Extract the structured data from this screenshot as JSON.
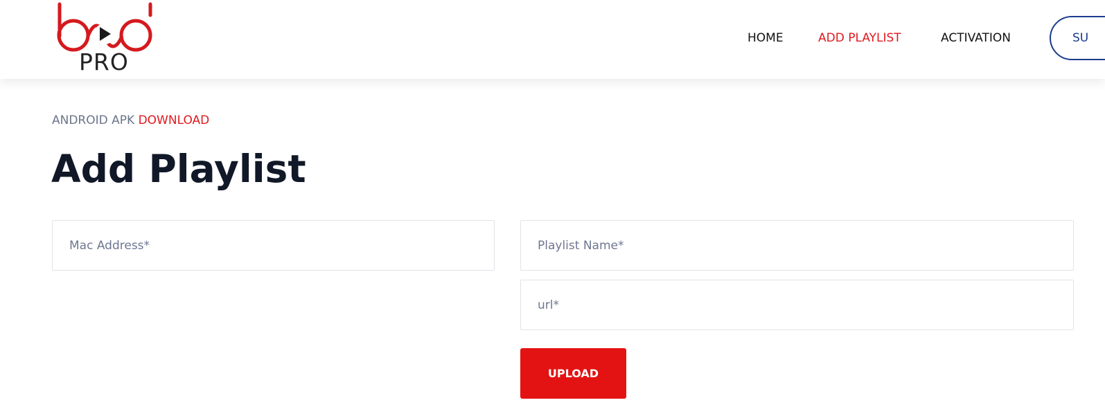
{
  "header": {
    "logo_text": "PRO",
    "nav": {
      "home": "HOME",
      "add_playlist": "ADD PLAYLIST",
      "activation": "ACTIVATION",
      "pill_label": "SU"
    }
  },
  "main": {
    "apk_prefix": "ANDROID APK",
    "apk_link": "DOWNLOAD",
    "title": "Add Playlist"
  },
  "form": {
    "mac_placeholder": "Mac Address*",
    "name_placeholder": "Playlist Name*",
    "url_placeholder": "url*",
    "upload_label": "UPLOAD"
  },
  "colors": {
    "accent": "#e0191e",
    "pill_border": "#1c3b8f",
    "upload_bg": "#e31313"
  },
  "icons": [
    "play-icon"
  ]
}
